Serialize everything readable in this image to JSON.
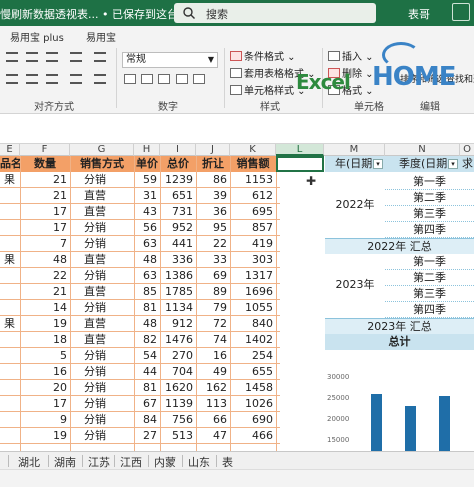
{
  "window": {
    "title": "慢刷新数据透视表... • 已保存到这台电脑 ⌄",
    "search_label": "搜索",
    "user": "表哥",
    "brand_color": "#217346"
  },
  "ribbon": {
    "tabs": [
      "易用宝 plus",
      "易用宝"
    ],
    "number_format": "常规",
    "styles": [
      "条件格式 ⌄",
      "套用表格格式 ⌄",
      "单元格样式 ⌄"
    ],
    "cells": [
      "插入 ⌄",
      "删除 ⌄",
      "格式 ⌄"
    ],
    "edit": [
      "排序和筛选",
      "查找和选"
    ],
    "groups": {
      "alignment": "对齐方式",
      "number": "数字",
      "styles": "样式",
      "cells": "单元格",
      "edit": "编辑"
    },
    "watermark": {
      "excel": "Excel",
      "home": "HOME"
    }
  },
  "columns": [
    "E",
    "F",
    "G",
    "H",
    "I",
    "J",
    "K",
    "L",
    "M",
    "N",
    "O"
  ],
  "table": {
    "headers": [
      "品名称",
      "数量",
      "销售方式",
      "单价",
      "总价",
      "折让",
      "销售额"
    ],
    "rows": [
      [
        "果",
        "21",
        "分销",
        "59",
        "1239",
        "86",
        "1153"
      ],
      [
        "",
        "21",
        "直营",
        "31",
        "651",
        "39",
        "612"
      ],
      [
        "",
        "17",
        "直营",
        "43",
        "731",
        "36",
        "695"
      ],
      [
        "",
        "17",
        "分销",
        "56",
        "952",
        "95",
        "857"
      ],
      [
        "",
        "7",
        "分销",
        "63",
        "441",
        "22",
        "419"
      ],
      [
        "果",
        "48",
        "直营",
        "48",
        "336",
        "33",
        "303"
      ],
      [
        "",
        "22",
        "分销",
        "63",
        "1386",
        "69",
        "1317"
      ],
      [
        "",
        "21",
        "直营",
        "85",
        "1785",
        "89",
        "1696"
      ],
      [
        "",
        "14",
        "分销",
        "81",
        "1134",
        "79",
        "1055"
      ],
      [
        "果",
        "19",
        "直营",
        "48",
        "912",
        "72",
        "840"
      ],
      [
        "",
        "18",
        "直营",
        "82",
        "1476",
        "74",
        "1402"
      ],
      [
        "",
        "5",
        "分销",
        "54",
        "270",
        "16",
        "254"
      ],
      [
        "",
        "16",
        "分销",
        "44",
        "704",
        "49",
        "655"
      ],
      [
        "",
        "20",
        "分销",
        "81",
        "1620",
        "162",
        "1458"
      ],
      [
        "",
        "17",
        "分销",
        "67",
        "1139",
        "113",
        "1026"
      ],
      [
        "",
        "9",
        "分销",
        "84",
        "756",
        "66",
        "690"
      ],
      [
        "",
        "19",
        "分销",
        "27",
        "513",
        "47",
        "466"
      ]
    ]
  },
  "pivot": {
    "headers": [
      "年(日期)",
      "季度(日期)",
      "求"
    ],
    "years": [
      {
        "year": "2022年",
        "quarters": [
          "第一季",
          "第二季",
          "第三季",
          "第四季"
        ],
        "subtotal": "2022年 汇总"
      },
      {
        "year": "2023年",
        "quarters": [
          "第一季",
          "第二季",
          "第三季",
          "第四季"
        ],
        "subtotal": "2023年 汇总"
      }
    ],
    "total": "总计"
  },
  "chart_data": {
    "type": "bar",
    "categories": [
      "",
      "",
      ""
    ],
    "values": [
      26000,
      23000,
      25500
    ],
    "yticks": [
      "30000",
      "25000",
      "20000",
      "15000"
    ],
    "ylim": [
      15000,
      30000
    ]
  },
  "sheet_tabs": [
    "湖北",
    "湖南",
    "江苏",
    "江西",
    "内蒙",
    "山东",
    "表"
  ]
}
